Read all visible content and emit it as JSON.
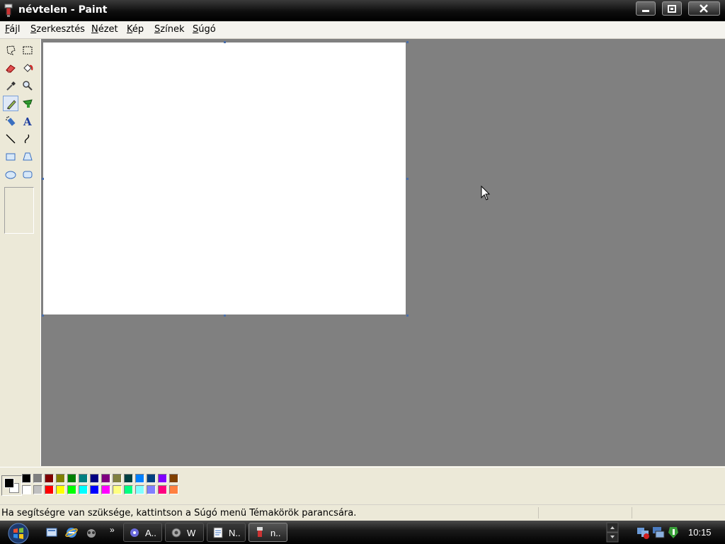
{
  "window": {
    "title": "névtelen - Paint"
  },
  "menu": [
    {
      "accel": "F",
      "rest": "ájl"
    },
    {
      "accel": "S",
      "rest": "zerkesztés"
    },
    {
      "accel": "N",
      "rest": "ézet"
    },
    {
      "accel": "K",
      "rest": "ép"
    },
    {
      "accel": "S",
      "rest": "zínek"
    },
    {
      "accel": "S",
      "rest": "úgó"
    }
  ],
  "tools": [
    {
      "name": "free-form-select",
      "icon": "free-select-icon"
    },
    {
      "name": "select",
      "icon": "rect-select-icon"
    },
    {
      "name": "eraser",
      "icon": "eraser-icon"
    },
    {
      "name": "fill",
      "icon": "fill-bucket-icon"
    },
    {
      "name": "pick-color",
      "icon": "eyedropper-icon"
    },
    {
      "name": "magnifier",
      "icon": "magnifier-icon"
    },
    {
      "name": "pencil",
      "icon": "pencil-icon",
      "active": true
    },
    {
      "name": "brush",
      "icon": "brush-icon"
    },
    {
      "name": "airbrush",
      "icon": "airbrush-icon"
    },
    {
      "name": "text",
      "icon": "text-icon"
    },
    {
      "name": "line",
      "icon": "line-icon"
    },
    {
      "name": "curve",
      "icon": "curve-icon"
    },
    {
      "name": "rectangle",
      "icon": "rectangle-icon"
    },
    {
      "name": "polygon",
      "icon": "polygon-icon"
    },
    {
      "name": "ellipse",
      "icon": "ellipse-icon"
    },
    {
      "name": "rounded-rectangle",
      "icon": "rounded-rect-icon"
    }
  ],
  "colors": {
    "foreground": "#000000",
    "background": "#ffffff",
    "palette_top": [
      "#000000",
      "#808080",
      "#800000",
      "#808000",
      "#008000",
      "#008080",
      "#000080",
      "#800080",
      "#808040",
      "#004040",
      "#0080ff",
      "#004080",
      "#8000ff",
      "#804000"
    ],
    "palette_bottom": [
      "#ffffff",
      "#c0c0c0",
      "#ff0000",
      "#ffff00",
      "#00ff00",
      "#00ffff",
      "#0000ff",
      "#ff00ff",
      "#ffff80",
      "#00ff80",
      "#80ffff",
      "#8080ff",
      "#ff0080",
      "#ff8040"
    ]
  },
  "status": {
    "help_text": "Ha segítségre van szüksége, kattintson a Súgó menü Témakörök parancsára."
  },
  "taskbar": {
    "quick_launch": [
      "show-desktop-icon",
      "ie-icon",
      "media-icon"
    ],
    "more_label": "»",
    "buttons": [
      {
        "label": "A..",
        "icon": "app-icon"
      },
      {
        "label": "W",
        "icon": "settings-icon"
      },
      {
        "label": "N..",
        "icon": "notepad-icon"
      },
      {
        "label": "n..",
        "icon": "paint-icon",
        "active": true
      }
    ],
    "clock": "10:15"
  }
}
